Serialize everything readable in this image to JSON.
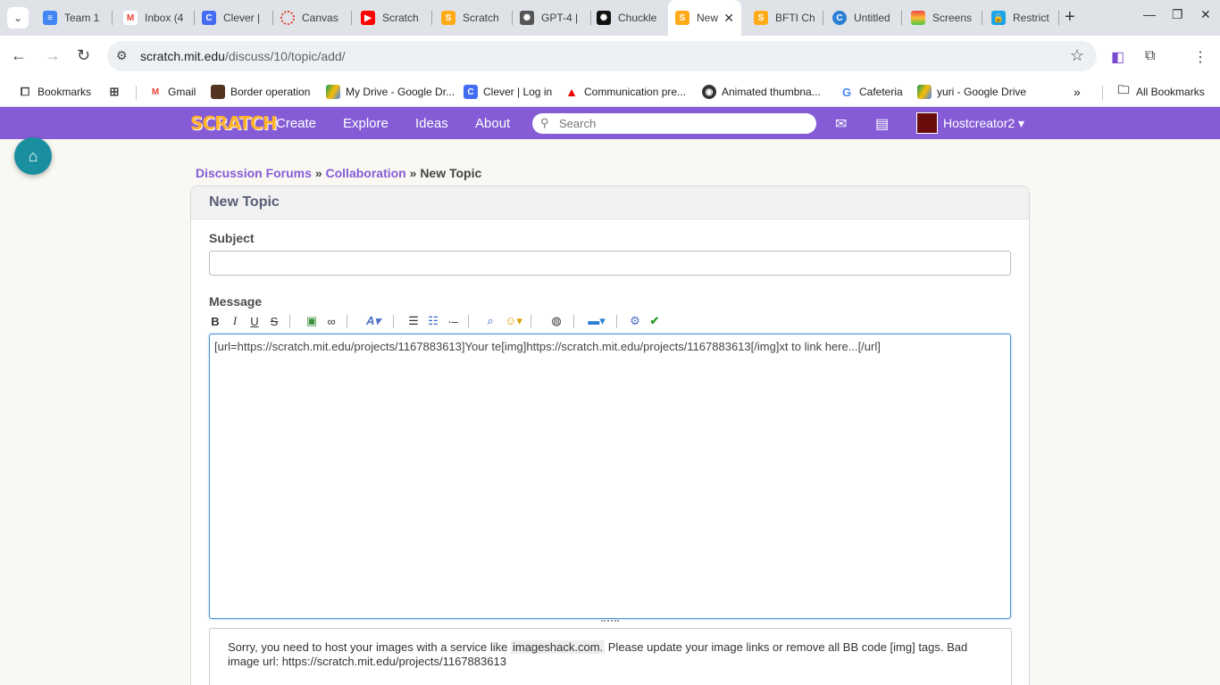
{
  "browser": {
    "tabs": [
      {
        "title": "Team 1",
        "icon": "docs-icon",
        "color": "#4285f4"
      },
      {
        "title": "Inbox (4",
        "icon": "gmail-icon",
        "color": "#ea4335"
      },
      {
        "title": "Clever |",
        "icon": "clever-icon",
        "color": "#436cf2"
      },
      {
        "title": "Canvas",
        "icon": "canvas-icon",
        "color": "#e13f2b"
      },
      {
        "title": "Scratch",
        "icon": "youtube-icon",
        "color": "#ff0000"
      },
      {
        "title": "Scratch",
        "icon": "scratch-icon",
        "color": "#ffab19"
      },
      {
        "title": "GPT-4 |",
        "icon": "openai-icon",
        "color": "#555555"
      },
      {
        "title": "Chuckle",
        "icon": "openai-icon",
        "color": "#111111"
      },
      {
        "title": "New",
        "icon": "scratch-icon",
        "color": "#ffab19"
      },
      {
        "title": "BFTI Ch",
        "icon": "scratch-icon",
        "color": "#ffab19"
      },
      {
        "title": "Untitled",
        "icon": "canva-icon",
        "color": "#2a7fd4"
      },
      {
        "title": "Screens",
        "icon": "rainbow-icon",
        "color": "#e44"
      },
      {
        "title": "Restrict",
        "icon": "lock-icon",
        "color": "#1aa3e8"
      }
    ],
    "active_tab_index": 8,
    "url_host": "scratch.mit.edu",
    "url_path": "/discuss/10/topic/add/",
    "bookmarks": [
      {
        "label": "Bookmarks",
        "icon": "bookmark-manager-icon"
      },
      {
        "label": "",
        "icon": "apps-icon"
      },
      {
        "label": "Gmail",
        "icon": "gmail-icon"
      },
      {
        "label": "Border operation",
        "icon": "image-icon"
      },
      {
        "label": "My Drive - Google Dr...",
        "icon": "drive-icon"
      },
      {
        "label": "Clever | Log in",
        "icon": "clever-icon"
      },
      {
        "label": "Communication pre...",
        "icon": "adobe-icon"
      },
      {
        "label": "Animated thumbna...",
        "icon": "globe-icon"
      },
      {
        "label": "Cafeteria",
        "icon": "google-icon"
      },
      {
        "label": "yuri - Google Drive",
        "icon": "drive-icon"
      }
    ],
    "all_bookmarks_label": "All Bookmarks"
  },
  "scratch_nav": {
    "logo_text": "SCRATCH",
    "links": [
      "Create",
      "Explore",
      "Ideas",
      "About"
    ],
    "search_placeholder": "Search",
    "username": "Hostcreator2"
  },
  "breadcrumb": {
    "forums": "Discussion Forums",
    "sep": "»",
    "category": "Collaboration",
    "current": "New Topic"
  },
  "form": {
    "title": "New Topic",
    "subject_label": "Subject",
    "subject_value": "",
    "message_label": "Message",
    "message_value": "[url=https://scratch.mit.edu/projects/1167883613]Your te[img]https://scratch.mit.edu/projects/1167883613[/img]xt to link here...[/url]",
    "error_prefix": "Sorry, you need to host your images with a service like",
    "error_host": "imageshack.com.",
    "error_suffix": "Please update your image links or remove all BB code [img] tags. Bad image url: https://scratch.mit.edu/projects/1167883613"
  },
  "colors": {
    "scratch_purple": "#855cd6",
    "link_purple": "#855cd6",
    "page_bg": "#f9f8f3"
  }
}
